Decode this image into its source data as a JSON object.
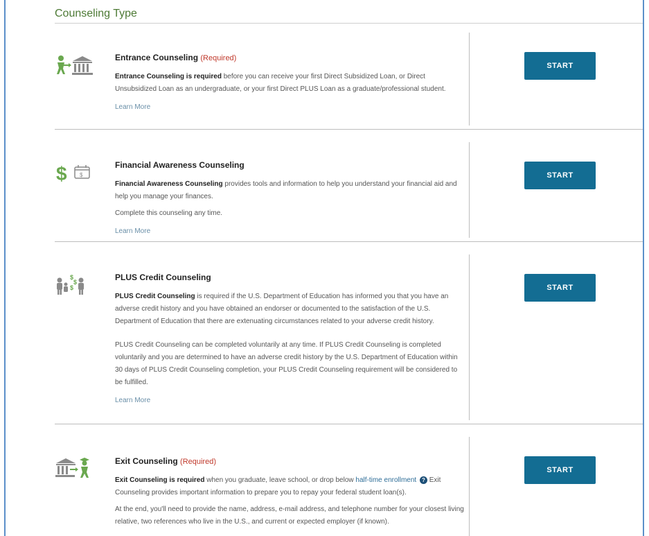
{
  "section": {
    "title": "Counseling Type"
  },
  "cards": [
    {
      "title": "Entrance Counseling",
      "required": "(Required)",
      "p1_bold": "Entrance Counseling is required",
      "p1_rest": " before you can receive your first Direct Subsidized Loan, or Direct Unsubsidized Loan as an undergraduate, or your first Direct PLUS Loan as a graduate/professional student.",
      "learn_more": "Learn More",
      "button": "START",
      "icon": "student-bank-icon"
    },
    {
      "title": "Financial Awareness Counseling",
      "p1_bold": "Financial Awareness Counseling",
      "p1_rest": " provides tools and information to help you understand your financial aid and help you manage your finances.",
      "p2": "Complete this counseling any time.",
      "learn_more": "Learn More",
      "button": "START",
      "icon": "dollar-calendar-icon"
    },
    {
      "title": "PLUS Credit Counseling",
      "p1_bold": "PLUS Credit Counseling",
      "p1_rest": " is required if the U.S. Department of Education has informed you that you have an adverse credit history and you have obtained an endorser or documented to the satisfaction of the U.S. Department of Education that there are extenuating circumstances related to your adverse credit history.",
      "p2": "PLUS Credit Counseling can be completed voluntarily at any time. If PLUS Credit Counseling is completed voluntarily and you are determined to have an adverse credit history by the U.S. Department of Education within 30 days of PLUS Credit Counseling completion, your PLUS Credit Counseling requirement will be considered to be fulfilled.",
      "learn_more": "Learn More",
      "button": "START",
      "icon": "family-money-icon"
    },
    {
      "title": "Exit Counseling",
      "required": "(Required)",
      "p1_bold": "Exit Counseling is required",
      "p1_rest": " when you graduate, leave school, or drop below ",
      "p1_link": "half-time enrollment",
      "p1_after": "Exit Counseling provides important information to prepare you to repay your federal student loan(s).",
      "p2": "At the end, you'll need to provide the name, address, e-mail address, and telephone number for your closest living relative, two references who live in the U.S., and current or expected employer (if known).",
      "button": "START",
      "icon": "bank-graduate-icon"
    }
  ],
  "colors": {
    "accent": "#136d93",
    "title_green": "#4d7a35",
    "required_red": "#c0392b",
    "icon_green": "#6aa84f"
  }
}
